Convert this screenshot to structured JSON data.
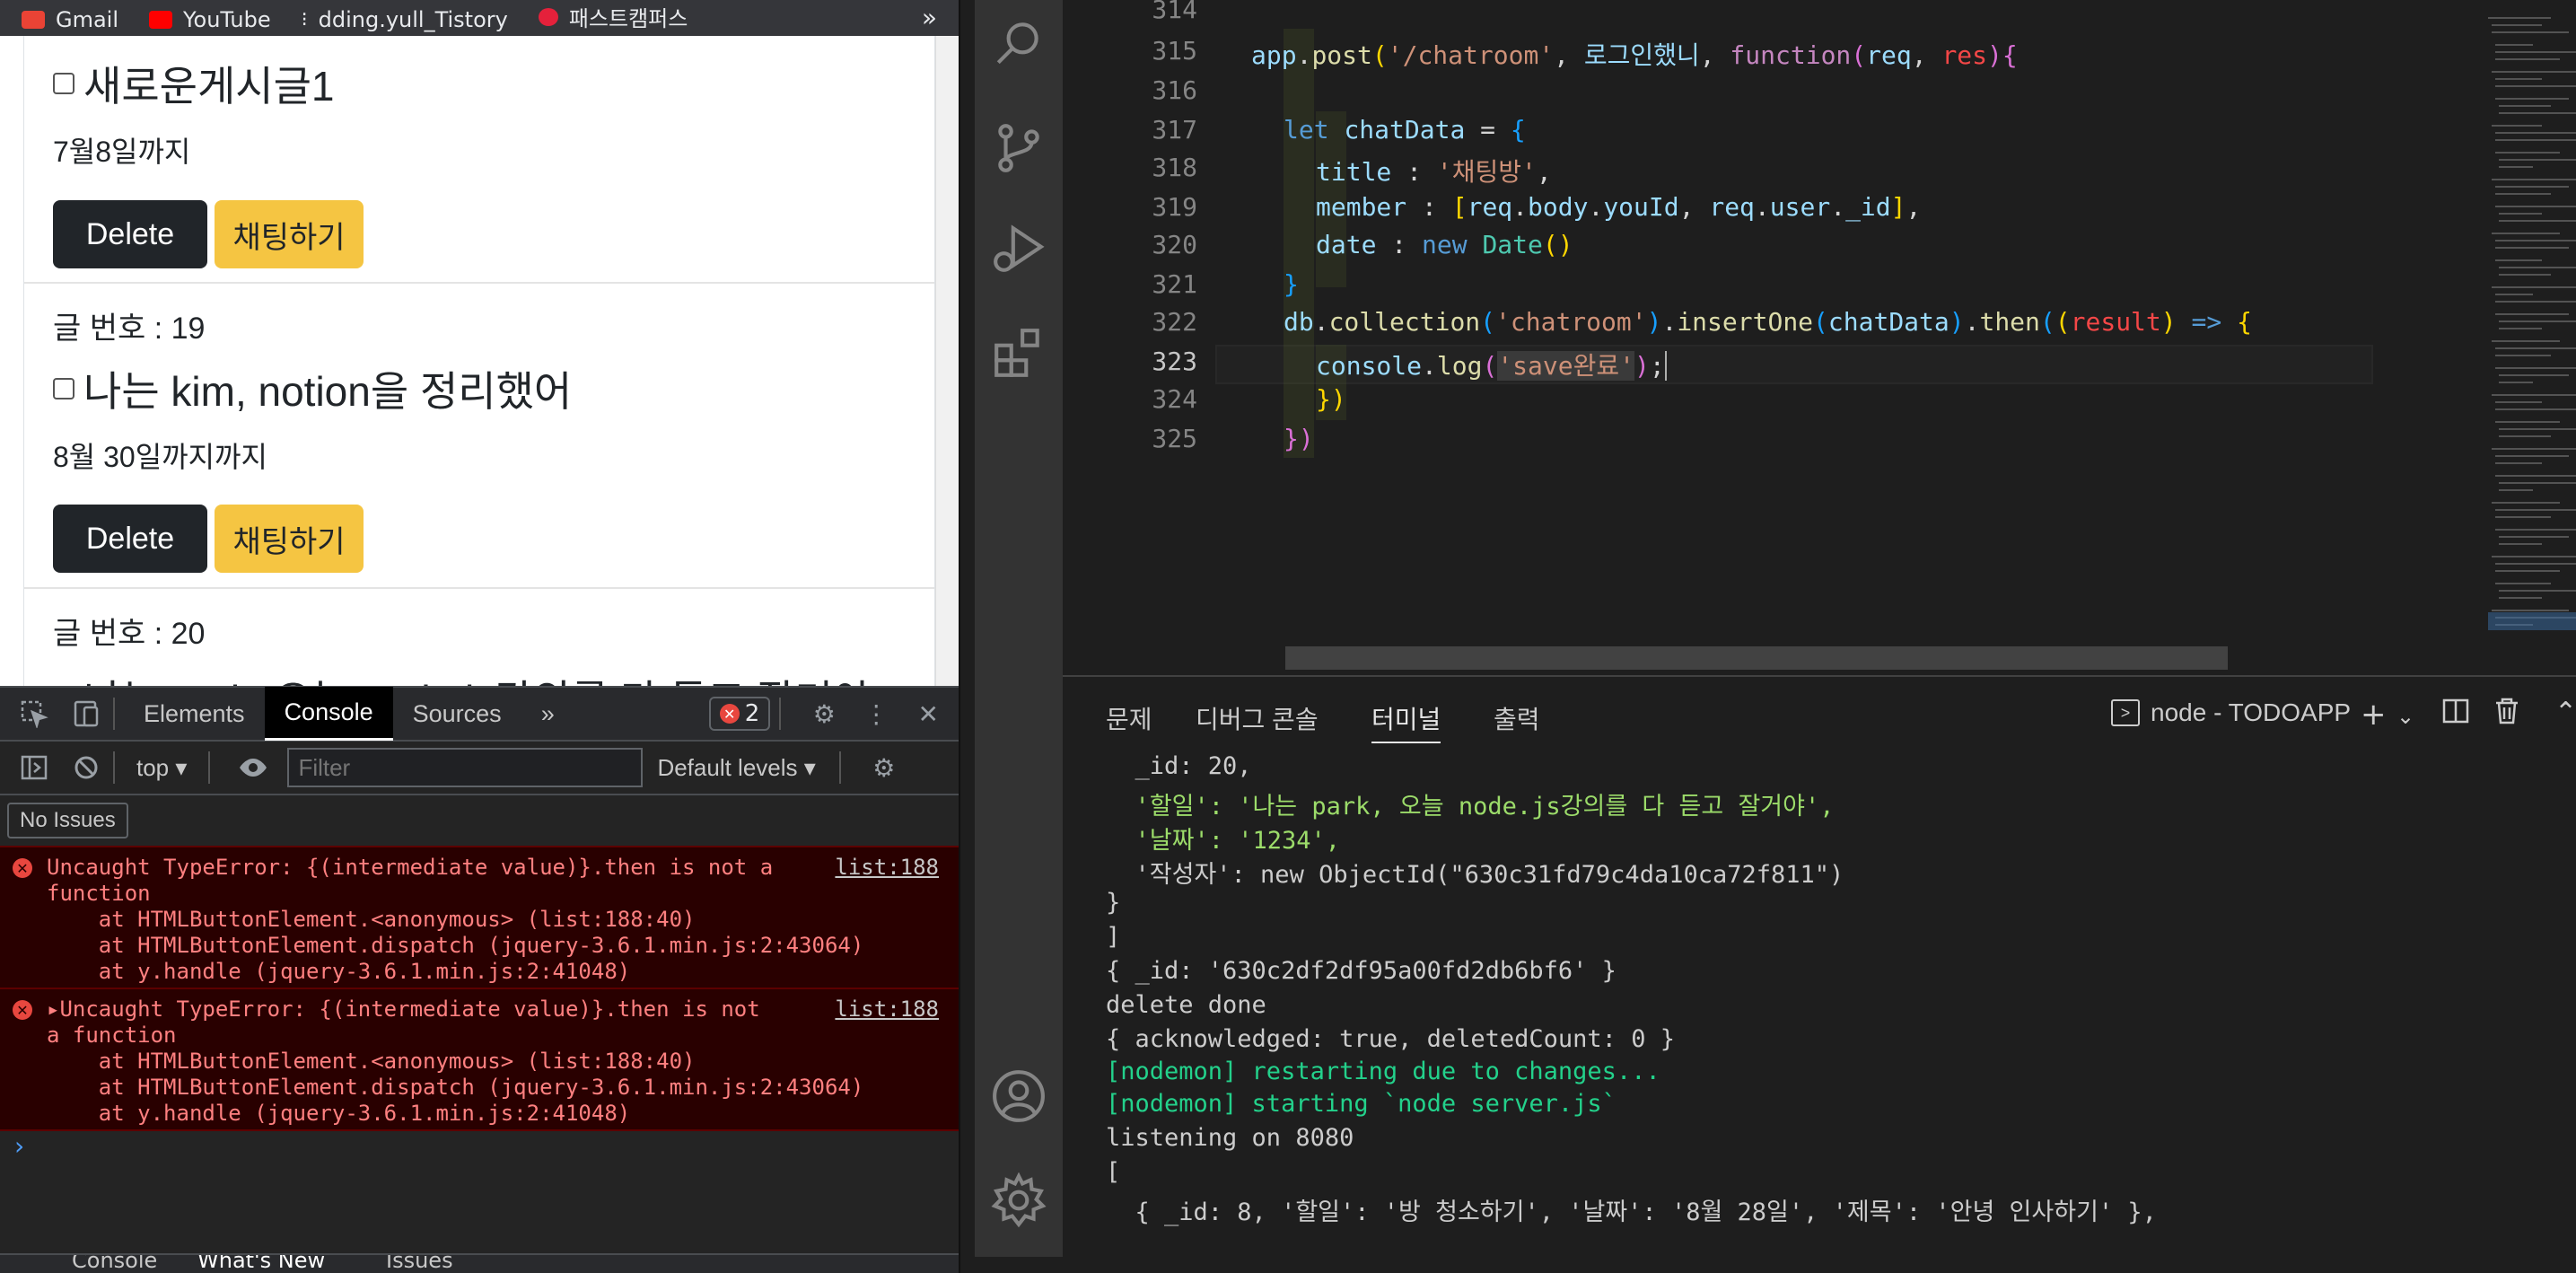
{
  "browser": {
    "bookmarks": [
      "Gmail",
      "YouTube",
      "dding.yull_Tistory",
      "패스트캠퍼스"
    ],
    "bookmarks_more": "»",
    "posts": [
      {
        "title": "새로운게시글1",
        "date": "7월8일까지",
        "delete_label": "Delete",
        "chat_label": "채팅하기",
        "number": ""
      },
      {
        "title": "나는 kim, notion을 정리했어",
        "date": "8월 30일까지까지",
        "delete_label": "Delete",
        "chat_label": "채팅하기",
        "number": "글 번호 : 19"
      },
      {
        "title": "나는 park, 오늘 node.js강의를 다 듣고 잘거야",
        "date": "",
        "delete_label": "",
        "chat_label": "",
        "number": "글 번호 : 20"
      }
    ]
  },
  "devtools": {
    "tabs": [
      "Elements",
      "Console",
      "Sources"
    ],
    "active_tab": "Console",
    "more_tabs": "»",
    "error_count": "2",
    "context": "top",
    "filter_placeholder": "Filter",
    "levels": "Default levels",
    "no_issues": "No Issues",
    "messages": [
      {
        "lines": [
          "Uncaught TypeError: {(intermediate value)}.then is not a",
          "function",
          "    at HTMLButtonElement.<anonymous> (list:188:40)",
          "    at HTMLButtonElement.dispatch (jquery-3.6.1.min.js:2:43064)",
          "    at y.handle (jquery-3.6.1.min.js:2:41048)"
        ],
        "source": "list:188"
      },
      {
        "lines": [
          "▸Uncaught TypeError: {(intermediate value)}.then is not",
          "a function",
          "    at HTMLButtonElement.<anonymous> (list:188:40)",
          "    at HTMLButtonElement.dispatch (jquery-3.6.1.min.js:2:43064)",
          "    at y.handle (jquery-3.6.1.min.js:2:41048)"
        ],
        "source": "list:188"
      }
    ],
    "prompt": "›",
    "drawer_tabs": [
      "Console",
      "What's New",
      "Issues"
    ]
  },
  "editor": {
    "line_numbers": [
      "314",
      "315",
      "316",
      "317",
      "318",
      "319",
      "320",
      "321",
      "322",
      "323",
      "324",
      "325"
    ],
    "current_line": "323"
  },
  "panel": {
    "tabs": [
      "문제",
      "디버그 콘솔",
      "터미널",
      "출력"
    ],
    "active_tab": "터미널",
    "terminal_name": "node - TODOAPP",
    "terminal_lines": [
      "  _id: 20,",
      "  '할일': '나는 park, 오늘 node.js강의를 다 듣고 잘거야',",
      "  '날짜': '1234',",
      "  '작성자': new ObjectId(\"630c31fd79c4da10ca72f811\")",
      "}",
      "]",
      "{ _id: '630c2df2df95a00fd2db6bf6' }",
      "delete done",
      "{ acknowledged: true, deletedCount: 0 }",
      "[nodemon] restarting due to changes...",
      "[nodemon] starting `node server.js`",
      "listening on 8080",
      "[",
      "  { _id: 8, '할일': '방 청소하기', '날짜': '8월 28일', '제목': '안녕 인사하기' },"
    ]
  }
}
